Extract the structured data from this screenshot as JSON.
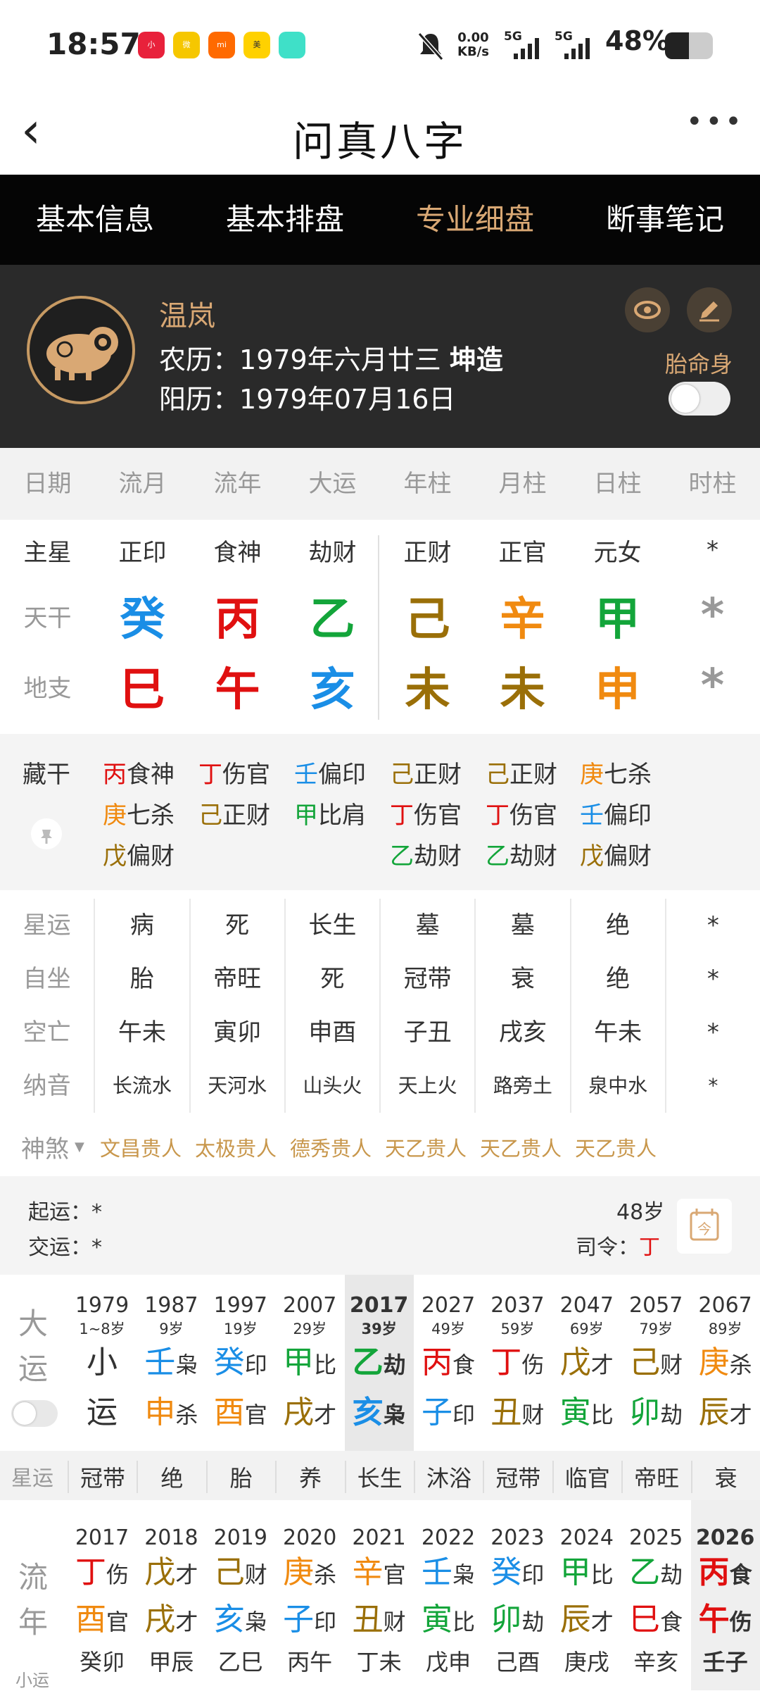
{
  "status": {
    "time": "18:57",
    "net_speed": "0.00",
    "net_unit": "KB/s",
    "sig1": "5G",
    "sig2": "5G",
    "battery": "48%"
  },
  "header": {
    "title": "问真八字"
  },
  "tabs": [
    "基本信息",
    "基本排盘",
    "专业细盘",
    "断事笔记"
  ],
  "profile": {
    "name": "温岚",
    "lunar_label": "农历：",
    "lunar": "1979年六月廿三",
    "gender": "坤造",
    "solar_label": "阳历：",
    "solar": "1979年07月16日",
    "taimingshen": "胎命身"
  },
  "columns": [
    "日期",
    "流月",
    "流年",
    "大运",
    "年柱",
    "月柱",
    "日柱",
    "时柱"
  ],
  "row_labels": {
    "main_star": "主星",
    "tiangan": "天干",
    "dizhi": "地支",
    "canggan": "藏干",
    "xingyun": "星运",
    "zizuo": "自坐",
    "kongwang": "空亡",
    "nayin": "纳音",
    "shensha": "神煞"
  },
  "main_star": [
    "正印",
    "食神",
    "劫财",
    "正财",
    "正官",
    "元女",
    "*"
  ],
  "tiangan": [
    "癸",
    "丙",
    "乙",
    "己",
    "辛",
    "甲",
    "*"
  ],
  "dizhi": [
    "巳",
    "午",
    "亥",
    "未",
    "未",
    "申",
    "*"
  ],
  "canggan": [
    [
      [
        "丙",
        "食神"
      ],
      [
        "庚",
        "七杀"
      ],
      [
        "戊",
        "偏财"
      ]
    ],
    [
      [
        "丁",
        "伤官"
      ],
      [
        "己",
        "正财"
      ]
    ],
    [
      [
        "壬",
        "偏印"
      ],
      [
        "甲",
        "比肩"
      ]
    ],
    [
      [
        "己",
        "正财"
      ],
      [
        "丁",
        "伤官"
      ],
      [
        "乙",
        "劫财"
      ]
    ],
    [
      [
        "己",
        "正财"
      ],
      [
        "丁",
        "伤官"
      ],
      [
        "乙",
        "劫财"
      ]
    ],
    [
      [
        "庚",
        "七杀"
      ],
      [
        "壬",
        "偏印"
      ],
      [
        "戊",
        "偏财"
      ]
    ]
  ],
  "xingyun": [
    "病",
    "死",
    "长生",
    "墓",
    "墓",
    "绝",
    "*"
  ],
  "zizuo": [
    "胎",
    "帝旺",
    "死",
    "冠带",
    "衰",
    "绝",
    "*"
  ],
  "kongwang": [
    "午未",
    "寅卯",
    "申酉",
    "子丑",
    "戌亥",
    "午未",
    "*"
  ],
  "nayin": [
    "长流水",
    "天河水",
    "山头火",
    "天上火",
    "路旁土",
    "泉中水",
    "*"
  ],
  "shensha": [
    "文昌贵人",
    "太极贵人",
    "德秀贵人",
    "天乙贵人",
    "天乙贵人",
    "天乙贵人"
  ],
  "qiyun": {
    "start_label": "起运：",
    "start": "*",
    "jiao_label": "交运：",
    "jiao": "*",
    "age": "48岁",
    "siling_label": "司令：",
    "siling": "丁",
    "cal_icon": "今"
  },
  "dayun": {
    "label1": "大",
    "label2": "运",
    "cols": [
      {
        "year": "1979",
        "age": "1~8岁",
        "g": "小",
        "gs": "",
        "z": "运",
        "zs": ""
      },
      {
        "year": "1987",
        "age": "9岁",
        "g": "壬",
        "gs": "枭",
        "z": "申",
        "zs": "杀"
      },
      {
        "year": "1997",
        "age": "19岁",
        "g": "癸",
        "gs": "印",
        "z": "酉",
        "zs": "官"
      },
      {
        "year": "2007",
        "age": "29岁",
        "g": "甲",
        "gs": "比",
        "z": "戌",
        "zs": "才"
      },
      {
        "year": "2017",
        "age": "39岁",
        "g": "乙",
        "gs": "劫",
        "z": "亥",
        "zs": "枭"
      },
      {
        "year": "2027",
        "age": "49岁",
        "g": "丙",
        "gs": "食",
        "z": "子",
        "zs": "印"
      },
      {
        "year": "2037",
        "age": "59岁",
        "g": "丁",
        "gs": "伤",
        "z": "丑",
        "zs": "财"
      },
      {
        "year": "2047",
        "age": "69岁",
        "g": "戊",
        "gs": "才",
        "z": "寅",
        "zs": "比"
      },
      {
        "year": "2057",
        "age": "79岁",
        "g": "己",
        "gs": "财",
        "z": "卯",
        "zs": "劫"
      },
      {
        "year": "2067",
        "age": "89岁",
        "g": "庚",
        "gs": "杀",
        "z": "辰",
        "zs": "才"
      }
    ]
  },
  "xingyun_row": {
    "label": "星运",
    "values": [
      "冠带",
      "绝",
      "胎",
      "养",
      "长生",
      "沐浴",
      "冠带",
      "临官",
      "帝旺",
      "衰"
    ]
  },
  "liunian": {
    "label1": "流",
    "label2": "年",
    "label3": "小运",
    "cols": [
      {
        "year": "2017",
        "g": "丁",
        "gs": "伤",
        "z": "酉",
        "zs": "官",
        "x": "癸卯"
      },
      {
        "year": "2018",
        "g": "戊",
        "gs": "才",
        "z": "戌",
        "zs": "才",
        "x": "甲辰"
      },
      {
        "year": "2019",
        "g": "己",
        "gs": "财",
        "z": "亥",
        "zs": "枭",
        "x": "乙巳"
      },
      {
        "year": "2020",
        "g": "庚",
        "gs": "杀",
        "z": "子",
        "zs": "印",
        "x": "丙午"
      },
      {
        "year": "2021",
        "g": "辛",
        "gs": "官",
        "z": "丑",
        "zs": "财",
        "x": "丁未"
      },
      {
        "year": "2022",
        "g": "壬",
        "gs": "枭",
        "z": "寅",
        "zs": "比",
        "x": "戊申"
      },
      {
        "year": "2023",
        "g": "癸",
        "gs": "印",
        "z": "卯",
        "zs": "劫",
        "x": "己酉"
      },
      {
        "year": "2024",
        "g": "甲",
        "gs": "比",
        "z": "辰",
        "zs": "才",
        "x": "庚戌"
      },
      {
        "year": "2025",
        "g": "乙",
        "gs": "劫",
        "z": "巳",
        "zs": "食",
        "x": "辛亥"
      },
      {
        "year": "2026",
        "g": "丙",
        "gs": "食",
        "z": "午",
        "zs": "伤",
        "x": "壬子"
      }
    ]
  },
  "colors": {
    "accent": "#d9a874",
    "tab_bg": "#050505",
    "profile_bg": "#2a2a2a"
  }
}
